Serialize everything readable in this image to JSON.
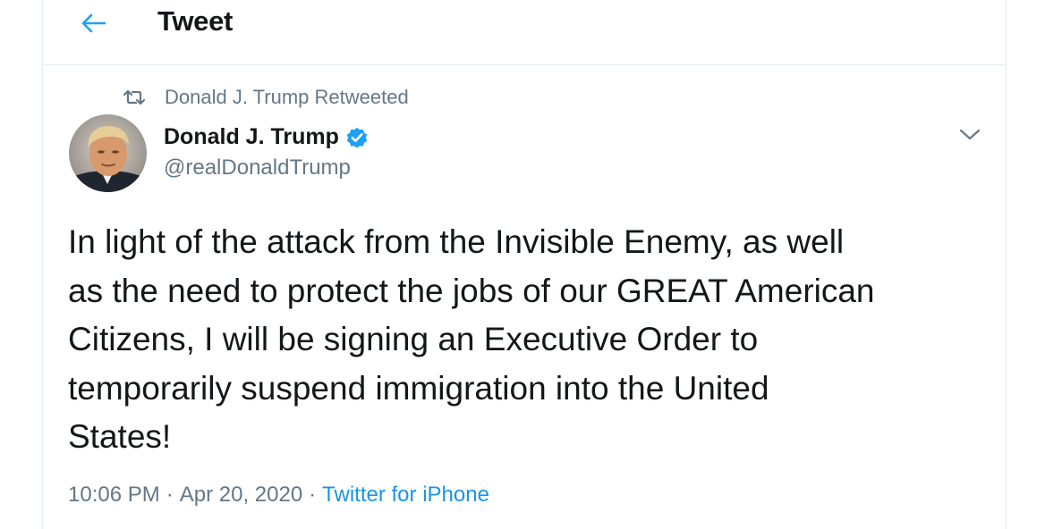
{
  "header": {
    "title": "Tweet",
    "back_icon": "arrow-left-icon"
  },
  "social_context": {
    "icon": "retweet-icon",
    "text": "Donald J. Trump Retweeted"
  },
  "author": {
    "name": "Donald J. Trump",
    "handle": "@realDonaldTrump",
    "verified": true
  },
  "tweet": {
    "text": "In light of the attack from the Invisible Enemy, as well\nas the need to protect the jobs of our GREAT American\nCitizens, I will be signing an Executive Order to\ntemporarily suspend immigration into the United\nStates!",
    "time": "10:06 PM",
    "date": "Apr 20, 2020",
    "separator": "·",
    "source": "Twitter for iPhone"
  },
  "colors": {
    "accent": "#1da1f2",
    "link": "#1b95e0",
    "secondary_text": "#657786",
    "primary_text": "#14171a",
    "border": "#e6ecf0"
  }
}
